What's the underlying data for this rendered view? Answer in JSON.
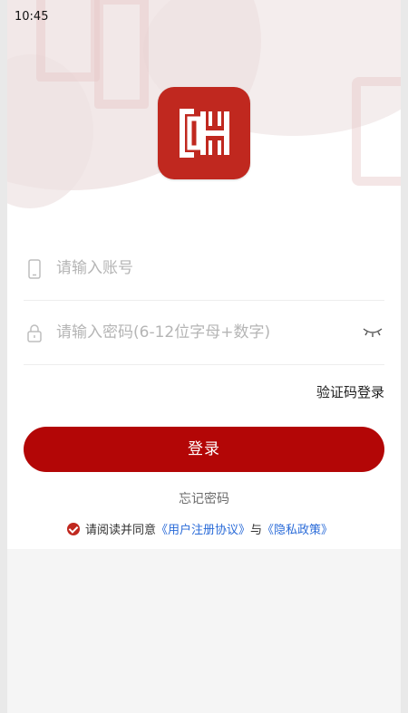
{
  "status_bar": {
    "time": "10:45"
  },
  "colors": {
    "brand": "#c0281f",
    "button": "#b30606",
    "link": "#2a6bd8"
  },
  "logo": {
    "icon": "ch-logo-icon"
  },
  "account": {
    "placeholder": "请输入账号",
    "value": "",
    "icon": "phone-icon"
  },
  "password": {
    "placeholder": "请输入密码(6-12位字母+数字)",
    "value": "",
    "icon": "lock-icon",
    "toggle_icon": "eye-closed-icon"
  },
  "links": {
    "sms_login": "验证码登录",
    "forgot_password": "忘记密码"
  },
  "login_button": {
    "label": "登录"
  },
  "agreement": {
    "checked": true,
    "prefix": "请阅读并同意",
    "user_agreement": "《用户注册协议》",
    "connector": "与",
    "privacy_policy": "《隐私政策》"
  }
}
